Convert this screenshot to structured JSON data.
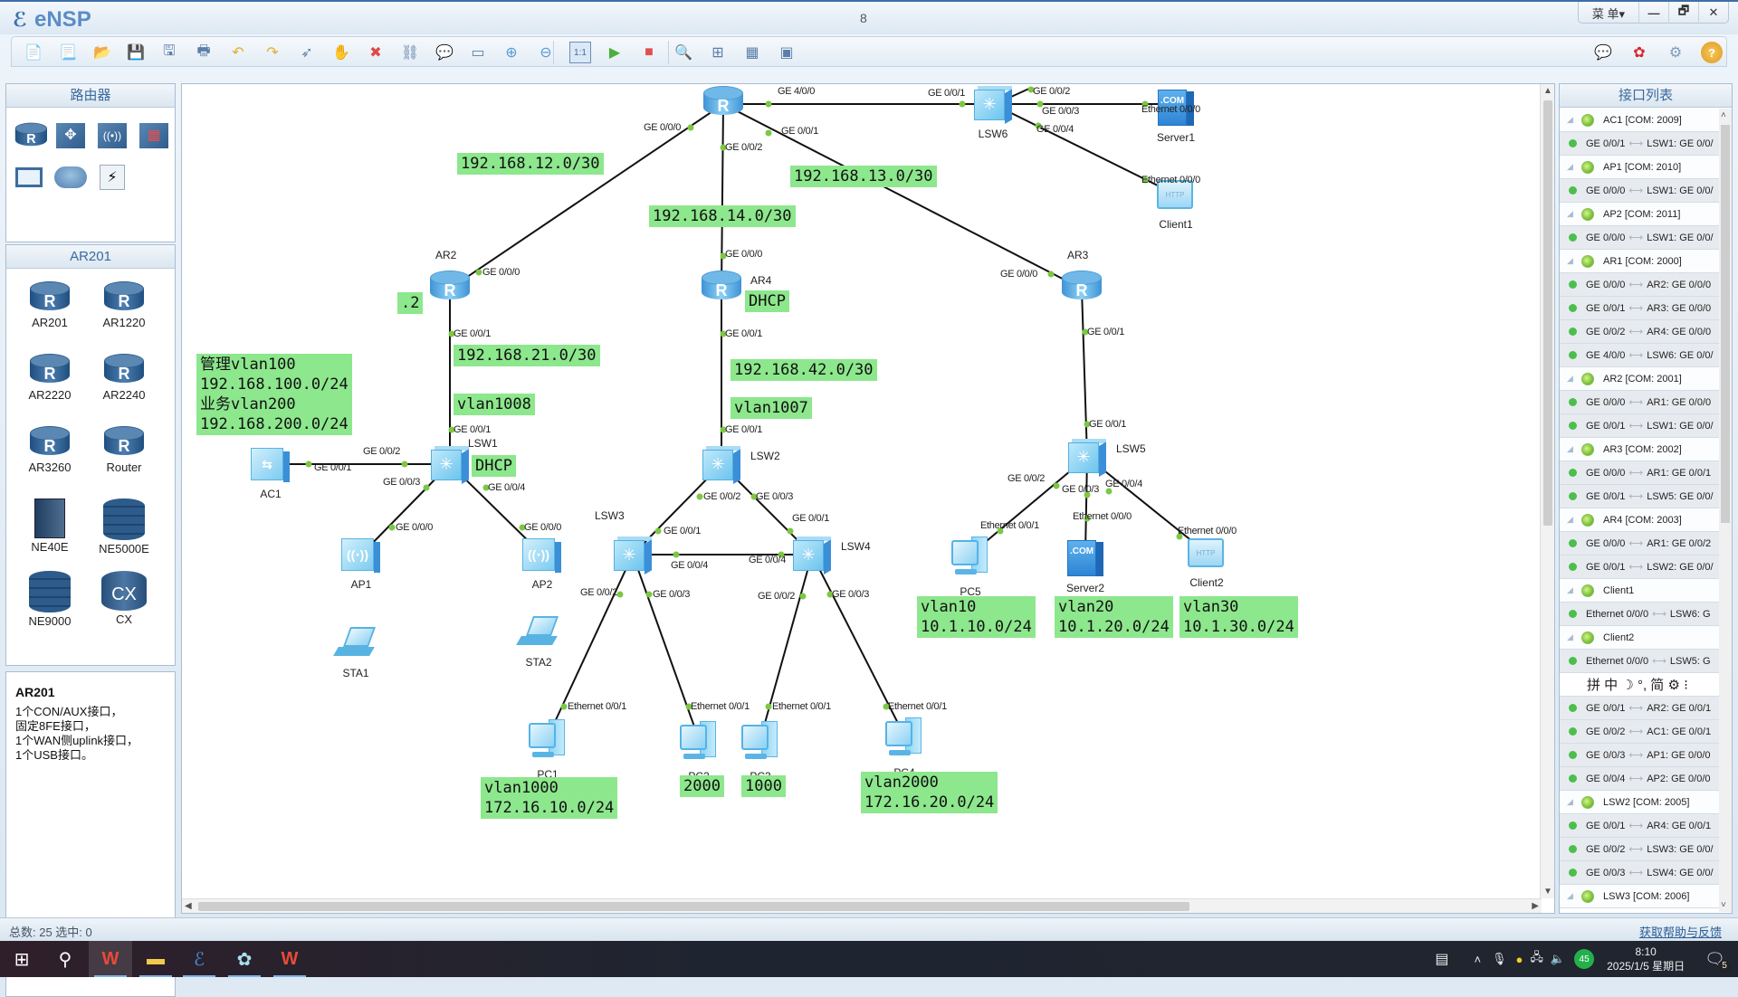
{
  "window": {
    "app_name": "eNSP",
    "title": "8",
    "menu_label": "菜 单▾",
    "minimize": "—",
    "restore": "🗗",
    "close": "✕"
  },
  "toolbar": {
    "buttons": [
      {
        "name": "new-topology",
        "glyph": "📄"
      },
      {
        "name": "new-example",
        "glyph": "📃"
      },
      {
        "name": "open",
        "glyph": "📂"
      },
      {
        "name": "save",
        "glyph": "💾"
      },
      {
        "name": "save-as",
        "glyph": "🖫"
      },
      {
        "name": "print",
        "glyph": "🖶"
      },
      {
        "name": "undo",
        "glyph": "↶"
      },
      {
        "name": "redo",
        "glyph": "↷"
      },
      {
        "name": "select",
        "glyph": "➶"
      },
      {
        "name": "pan",
        "glyph": "✋"
      },
      {
        "name": "delete",
        "glyph": "✖"
      },
      {
        "name": "delete-link",
        "glyph": "⛓"
      },
      {
        "name": "text",
        "glyph": "💬"
      },
      {
        "name": "palette",
        "glyph": "▭"
      },
      {
        "name": "zoom-in",
        "glyph": "⊕"
      },
      {
        "name": "zoom-out",
        "glyph": "⊖"
      },
      {
        "name": "fit-1-1",
        "glyph": "1:1"
      },
      {
        "name": "start-devices",
        "glyph": "▶"
      },
      {
        "name": "stop-devices",
        "glyph": "■"
      },
      {
        "name": "capture",
        "glyph": "🔍"
      },
      {
        "name": "topology",
        "glyph": "⊞"
      },
      {
        "name": "grid",
        "glyph": "▦"
      },
      {
        "name": "console",
        "glyph": "▣"
      }
    ],
    "right_buttons": [
      {
        "name": "feedback",
        "glyph": "💬"
      },
      {
        "name": "huawei",
        "glyph": "✿"
      },
      {
        "name": "settings",
        "glyph": "⚙"
      },
      {
        "name": "help",
        "glyph": "?"
      }
    ]
  },
  "left_panel": {
    "category_title": "路由器",
    "categories": [
      "router",
      "switch",
      "wireless",
      "firewall",
      "terminal",
      "cloud",
      "link"
    ],
    "device_title": "AR201",
    "devices": [
      "AR201",
      "AR1220",
      "AR2220",
      "AR2240",
      "AR3260",
      "Router",
      "NE40E",
      "NE5000E",
      "NE9000",
      "CX"
    ],
    "description": {
      "title": "AR201",
      "lines": [
        "1个CON/AUX接口，",
        "固定8FE接口，",
        "1个WAN侧uplink接口，",
        "1个USB接口。"
      ]
    }
  },
  "topology": {
    "nodes": [
      {
        "id": "AR1",
        "type": "router",
        "label": ""
      },
      {
        "id": "LSW6",
        "type": "switch",
        "label": "LSW6"
      },
      {
        "id": "Server1",
        "type": "server",
        "label": "Server1"
      },
      {
        "id": "Client1",
        "type": "client",
        "label": "Client1"
      },
      {
        "id": "AR2",
        "type": "router",
        "label": "AR2"
      },
      {
        "id": "AR4",
        "type": "router",
        "label": "AR4"
      },
      {
        "id": "AR3",
        "type": "router",
        "label": "AR3"
      },
      {
        "id": "LSW1",
        "type": "switch",
        "label": "LSW1"
      },
      {
        "id": "AC1",
        "type": "ac",
        "label": "AC1"
      },
      {
        "id": "AP1",
        "type": "ap",
        "label": "AP1"
      },
      {
        "id": "AP2",
        "type": "ap",
        "label": "AP2"
      },
      {
        "id": "STA1",
        "type": "sta",
        "label": "STA1"
      },
      {
        "id": "STA2",
        "type": "sta",
        "label": "STA2"
      },
      {
        "id": "LSW2",
        "type": "switch",
        "label": "LSW2"
      },
      {
        "id": "LSW3",
        "type": "switch",
        "label": "LSW3"
      },
      {
        "id": "LSW4",
        "type": "switch",
        "label": "LSW4"
      },
      {
        "id": "PC1",
        "type": "pc",
        "label": "PC1"
      },
      {
        "id": "PC2",
        "type": "pc",
        "label": "PC2"
      },
      {
        "id": "PC3",
        "type": "pc",
        "label": "PC3"
      },
      {
        "id": "PC4",
        "type": "pc",
        "label": "PC4"
      },
      {
        "id": "LSW5",
        "type": "switch",
        "label": "LSW5"
      },
      {
        "id": "PC5",
        "type": "pc",
        "label": "PC5"
      },
      {
        "id": "Server2",
        "type": "server",
        "label": "Server2"
      },
      {
        "id": "Client2",
        "type": "client",
        "label": "Client2"
      }
    ],
    "links": [
      {
        "a": "AR1",
        "b": "LSW6",
        "a_port": "GE 4/0/0",
        "b_port": "GE 0/0/1"
      },
      {
        "a": "LSW6",
        "b": "Server1",
        "a_port": "GE 0/0/3",
        "b_port": "Ethernet 0/0/0"
      },
      {
        "a": "LSW6",
        "b": "Client1",
        "a_port": "GE 0/0/4",
        "b_port": "Ethernet 0/0/0"
      },
      {
        "a": "AR1",
        "b": "AR2",
        "a_port": "GE 0/0/0",
        "b_port": "GE 0/0/0"
      },
      {
        "a": "AR1",
        "b": "AR4",
        "a_port": "GE 0/0/2",
        "b_port": "GE 0/0/0"
      },
      {
        "a": "AR1",
        "b": "AR3",
        "a_port": "GE 0/0/1",
        "b_port": "GE 0/0/0"
      },
      {
        "a": "AR2",
        "b": "LSW1",
        "a_port": "GE 0/0/1",
        "b_port": "GE 0/0/1"
      },
      {
        "a": "LSW1",
        "b": "AC1",
        "a_port": "GE 0/0/2",
        "b_port": "GE 0/0/1"
      },
      {
        "a": "LSW1",
        "b": "AP1",
        "a_port": "GE 0/0/3",
        "b_port": "GE 0/0/0"
      },
      {
        "a": "LSW1",
        "b": "AP2",
        "a_port": "GE 0/0/4",
        "b_port": "GE 0/0/0"
      },
      {
        "a": "AR4",
        "b": "LSW2",
        "a_port": "GE 0/0/1",
        "b_port": "GE 0/0/1"
      },
      {
        "a": "LSW2",
        "b": "LSW3",
        "a_port": "GE 0/0/2",
        "b_port": "GE 0/0/1"
      },
      {
        "a": "LSW2",
        "b": "LSW4",
        "a_port": "GE 0/0/3",
        "b_port": "GE 0/0/1"
      },
      {
        "a": "LSW3",
        "b": "LSW4",
        "a_port": "GE 0/0/4",
        "b_port": "GE 0/0/4"
      },
      {
        "a": "LSW3",
        "b": "PC1",
        "a_port": "GE 0/0/2",
        "b_port": "Ethernet 0/0/1"
      },
      {
        "a": "LSW3",
        "b": "PC2",
        "a_port": "GE 0/0/3",
        "b_port": "Ethernet 0/0/1"
      },
      {
        "a": "LSW4",
        "b": "PC3",
        "a_port": "GE 0/0/2",
        "b_port": "Ethernet 0/0/1"
      },
      {
        "a": "LSW4",
        "b": "PC4",
        "a_port": "GE 0/0/3",
        "b_port": "Ethernet 0/0/1"
      },
      {
        "a": "AR3",
        "b": "LSW5",
        "a_port": "GE 0/0/1",
        "b_port": "GE 0/0/1"
      },
      {
        "a": "LSW5",
        "b": "PC5",
        "a_port": "GE 0/0/2",
        "b_port": "Ethernet 0/0/1"
      },
      {
        "a": "LSW5",
        "b": "Server2",
        "a_port": "GE 0/0/3",
        "b_port": "Ethernet 0/0/0"
      },
      {
        "a": "LSW5",
        "b": "Client2",
        "a_port": "GE 0/0/4",
        "b_port": "Ethernet 0/0/0"
      }
    ],
    "extra_ports": [
      {
        "node": "LSW6",
        "port": "GE 0/0/2"
      }
    ],
    "notes": [
      {
        "id": "n-12",
        "text": "192.168.12.0/30"
      },
      {
        "id": "n-14",
        "text": "192.168.14.0/30"
      },
      {
        "id": "n-13",
        "text": "192.168.13.0/30"
      },
      {
        "id": "n-dot2",
        "text": ".2"
      },
      {
        "id": "n-21",
        "text": "192.168.21.0/30"
      },
      {
        "id": "n-vlan1008",
        "text": "vlan1008"
      },
      {
        "id": "n-mgmt",
        "text": "管理vlan100\n192.168.100.0/24\n业务vlan200\n192.168.200.0/24"
      },
      {
        "id": "n-lsw1-dhcp",
        "text": "DHCP"
      },
      {
        "id": "n-ar4-dhcp",
        "text": "DHCP"
      },
      {
        "id": "n-42",
        "text": "192.168.42.0/30"
      },
      {
        "id": "n-vlan1007",
        "text": "vlan1007"
      },
      {
        "id": "n-pc1",
        "text": "vlan1000\n172.16.10.0/24"
      },
      {
        "id": "n-pc2",
        "text": "2000"
      },
      {
        "id": "n-pc3",
        "text": "1000"
      },
      {
        "id": "n-pc4",
        "text": "vlan2000\n172.16.20.0/24"
      },
      {
        "id": "n-vlan10",
        "text": "vlan10\n10.1.10.0/24"
      },
      {
        "id": "n-vlan20",
        "text": "vlan20\n10.1.20.0/24"
      },
      {
        "id": "n-vlan30",
        "text": "vlan30\n10.1.30.0/24"
      }
    ]
  },
  "interface_panel": {
    "title": "接口列表",
    "rows": [
      {
        "kind": "dev",
        "text": "AC1 [COM: 2009]"
      },
      {
        "kind": "link",
        "local": "GE 0/0/1",
        "remote": "LSW1: GE 0/0/"
      },
      {
        "kind": "dev",
        "text": "AP1 [COM: 2010]"
      },
      {
        "kind": "link",
        "local": "GE 0/0/0",
        "remote": "LSW1: GE 0/0/"
      },
      {
        "kind": "dev",
        "text": "AP2 [COM: 2011]"
      },
      {
        "kind": "link",
        "local": "GE 0/0/0",
        "remote": "LSW1: GE 0/0/"
      },
      {
        "kind": "dev",
        "text": "AR1 [COM: 2000]"
      },
      {
        "kind": "link",
        "local": "GE 0/0/0",
        "remote": "AR2: GE 0/0/0"
      },
      {
        "kind": "link",
        "local": "GE 0/0/1",
        "remote": "AR3: GE 0/0/0"
      },
      {
        "kind": "link",
        "local": "GE 0/0/2",
        "remote": "AR4: GE 0/0/0"
      },
      {
        "kind": "link",
        "local": "GE 4/0/0",
        "remote": "LSW6: GE 0/0/"
      },
      {
        "kind": "dev",
        "text": "AR2 [COM: 2001]"
      },
      {
        "kind": "link",
        "local": "GE 0/0/0",
        "remote": "AR1: GE 0/0/0"
      },
      {
        "kind": "link",
        "local": "GE 0/0/1",
        "remote": "LSW1: GE 0/0/"
      },
      {
        "kind": "dev",
        "text": "AR3 [COM: 2002]"
      },
      {
        "kind": "link",
        "local": "GE 0/0/0",
        "remote": "AR1: GE 0/0/1"
      },
      {
        "kind": "link",
        "local": "GE 0/0/1",
        "remote": "LSW5: GE 0/0/"
      },
      {
        "kind": "dev",
        "text": "AR4 [COM: 2003]"
      },
      {
        "kind": "link",
        "local": "GE 0/0/0",
        "remote": "AR1: GE 0/0/2"
      },
      {
        "kind": "link",
        "local": "GE 0/0/1",
        "remote": "LSW2: GE 0/0/"
      },
      {
        "kind": "dev",
        "text": "Client1"
      },
      {
        "kind": "link",
        "local": "Ethernet 0/0/0",
        "remote": "LSW6: G"
      },
      {
        "kind": "dev",
        "text": "Client2"
      },
      {
        "kind": "link",
        "local": "Ethernet 0/0/0",
        "remote": "LSW5: G"
      },
      {
        "kind": "ime",
        "text": "拼 中 ☽ °, 简 ⚙ ⁝"
      },
      {
        "kind": "link",
        "local": "GE 0/0/1",
        "remote": "AR2: GE 0/0/1"
      },
      {
        "kind": "link",
        "local": "GE 0/0/2",
        "remote": "AC1: GE 0/0/1"
      },
      {
        "kind": "link",
        "local": "GE 0/0/3",
        "remote": "AP1: GE 0/0/0"
      },
      {
        "kind": "link",
        "local": "GE 0/0/4",
        "remote": "AP2: GE 0/0/0"
      },
      {
        "kind": "dev",
        "text": "LSW2 [COM: 2005]"
      },
      {
        "kind": "link",
        "local": "GE 0/0/1",
        "remote": "AR4: GE 0/0/1"
      },
      {
        "kind": "link",
        "local": "GE 0/0/2",
        "remote": "LSW3: GE 0/0/"
      },
      {
        "kind": "link",
        "local": "GE 0/0/3",
        "remote": "LSW4: GE 0/0/"
      },
      {
        "kind": "dev",
        "text": "LSW3 [COM: 2006]"
      }
    ]
  },
  "status": {
    "left": "总数: 25  选中: 0",
    "help_link": "获取帮助与反馈"
  },
  "taskbar": {
    "items": [
      "start",
      "search",
      "wps",
      "file-explorer",
      "ensp",
      "app-flower",
      "wps-2"
    ],
    "tray": {
      "battery_badge": "45",
      "time": "8:10",
      "date": "2025/1/5 星期日",
      "notification_count": "5"
    }
  }
}
